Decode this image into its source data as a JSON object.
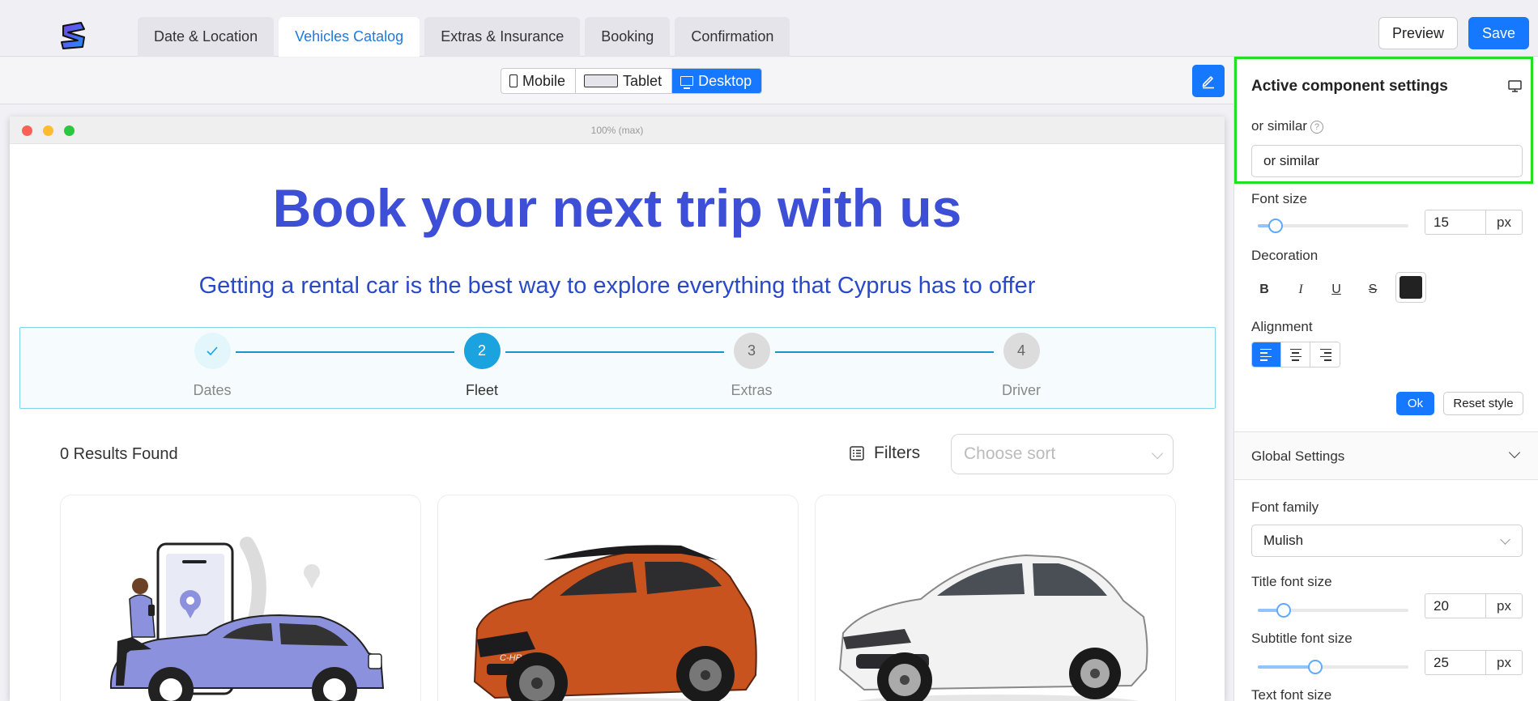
{
  "header": {
    "tabs": [
      {
        "label": "Date & Location",
        "active": false
      },
      {
        "label": "Vehicles Catalog",
        "active": true
      },
      {
        "label": "Extras & Insurance",
        "active": false
      },
      {
        "label": "Booking",
        "active": false
      },
      {
        "label": "Confirmation",
        "active": false
      }
    ],
    "preview_label": "Preview",
    "save_label": "Save"
  },
  "device_bar": {
    "devices": [
      {
        "label": "Mobile",
        "icon": "mobile-icon",
        "active": false
      },
      {
        "label": "Tablet",
        "icon": "tablet-icon",
        "active": false
      },
      {
        "label": "Desktop",
        "icon": "desktop-icon",
        "active": true
      }
    ],
    "edit_icon": "pencil-icon"
  },
  "preview": {
    "zoom_label": "100% (max)",
    "hero_title": "Book your next trip with us",
    "hero_subtitle": "Getting a rental car is the best way to explore everything that Cyprus has to offer",
    "steps": [
      {
        "number": "",
        "label": "Dates",
        "state": "done"
      },
      {
        "number": "2",
        "label": "Fleet",
        "state": "current"
      },
      {
        "number": "3",
        "label": "Extras",
        "state": "upcoming"
      },
      {
        "number": "4",
        "label": "Driver",
        "state": "upcoming"
      }
    ],
    "results_text": "0 Results Found",
    "filters_label": "Filters",
    "sort_placeholder": "Choose sort",
    "cards": [
      {
        "image": "car-rental-illustration"
      },
      {
        "image": "orange-suv-photo"
      },
      {
        "image": "white-sedan-photo"
      }
    ]
  },
  "settings": {
    "title": "Active component settings",
    "field_label": "or similar",
    "field_value": "or similar",
    "font_size_label": "Font size",
    "font_size_value": "15",
    "font_size_fraction": 0.12,
    "unit": "px",
    "decoration_label": "Decoration",
    "decoration_buttons": [
      "B",
      "I",
      "U",
      "S"
    ],
    "decoration_color": "#222222",
    "alignment_label": "Alignment",
    "ok_label": "Ok",
    "reset_label": "Reset style",
    "global_label": "Global Settings",
    "font_family_label": "Font family",
    "font_family_value": "Mulish",
    "title_font_size_label": "Title font size",
    "title_font_size_value": "20",
    "title_font_size_fraction": 0.17,
    "subtitle_font_size_label": "Subtitle font size",
    "subtitle_font_size_value": "25",
    "subtitle_font_size_fraction": 0.38,
    "text_font_size_label": "Text font size"
  },
  "colors": {
    "accent": "#1677ff",
    "hero_title": "#3d4fd6",
    "highlight": "#22e022",
    "step_active": "#1aa3de"
  }
}
